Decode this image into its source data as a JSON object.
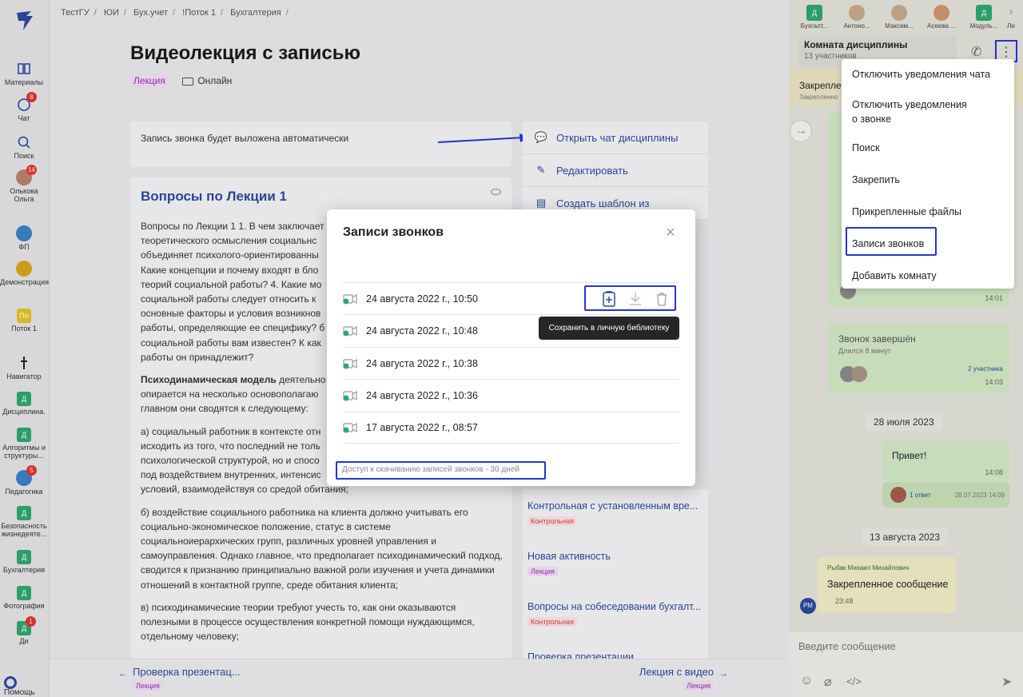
{
  "breadcrumb": [
    "ТестГУ",
    "ЮИ",
    "Бух.учет",
    "!Поток 1",
    "Бухгалтерия"
  ],
  "page": {
    "title": "Видеолекция с записью",
    "type_tag": "Лекция",
    "format": "Онлайн"
  },
  "notice": "Запись звонка будет выложена автоматически",
  "questions": {
    "title": "Вопросы по Лекции 1",
    "paragraphs": [
      "Вопросы по Лекции 1 1. В чем заключает",
      "теоретического осмысления социальнс",
      "объединяет психолого-ориентированны",
      "Какие концепции и почему входят в бло",
      "теорий социальной работы? 4. Какие мо",
      "социальной работы следует относить к",
      "основные факторы и условия возникнов",
      "работы, определяющие ее специфику? б",
      "социальной работы вам известен? К как",
      "работы он принадлежит?"
    ],
    "model_bold": "Психодинамическая модель",
    "model_rest": " деятельно",
    "model_lines": [
      "опирается на несколько основополагаю",
      "главном они сводятся к следующему:"
    ],
    "para_a": [
      "а) социальный работник в контексте отн",
      "исходить из того, что последний не толь",
      "психологической структурой, но и спосо",
      "под воздействием внутренних, интенсис",
      "условий, взаимодействуя со средой обитания;"
    ],
    "para_b": "б) воздействие социального работника на клиента должно учитывать его социально-экономическое положение, статус в системе социальноиерархических групп, различных уровней управления и самоуправления. Однако главное, что предполагает психодинамический подход, сводится к признанию принципиально важной роли изучения и учета динамики отношений в контактной группе, среде обитания клиента;",
    "para_c": "в) психодинамические теории требуют учесть то, как они оказываются полезными в процессе осуществления конкретной помощи нуждающимся, отдельному человеку;"
  },
  "actions": {
    "open_chat": "Открыть чат дисциплины",
    "edit": "Редактировать",
    "create_template": "Создать шаблон из"
  },
  "lessons": [
    {
      "title": "Контрольная с установленным вре...",
      "tag": "Контрольная"
    },
    {
      "title": "Новая активность",
      "tag": "Лекция"
    },
    {
      "title": "Вопросы на собеседовании бухгалт...",
      "tag": "Контрольная"
    },
    {
      "title": "Проверка презентации",
      "tag": ""
    }
  ],
  "footer": {
    "prev_title": "Проверка презентац...",
    "prev_tag": "Лекция",
    "next_title": "Лекция с видео",
    "next_tag": "Лекция"
  },
  "sidebar": {
    "materials": "Материалы",
    "chat": "Чат",
    "chat_badge": "8",
    "search": "Поиск",
    "user": "Олькова Ольга",
    "user_badge": "14",
    "fp": "ФП",
    "demo": "Демонстрация",
    "stream": "Поток 1",
    "stream_initials": "По",
    "navigator": "Навигатор",
    "discipline": "Дисциплина.",
    "algorithms": "Алгоритмы и структуры...",
    "pedagogy": "Педагогика",
    "pedagogy_badge": "5",
    "safety": "Безопасность жизнедеяте...",
    "accounting": "Бухгалтерия",
    "photo": "Фотография",
    "di": "Ди",
    "di_badge": "1",
    "letter": "Д",
    "help": "Помощь"
  },
  "chat_panel": {
    "avatars": [
      "Бухгалт...",
      "Антоно...",
      "Максим...",
      "Асеева ...",
      "Модуль...",
      "Ли"
    ],
    "room_title": "Комната дисциплины",
    "room_sub": "13 участников",
    "pinned_label": "Закреплен",
    "pinned_sub": "Закрепленно",
    "time1": "14:01",
    "call_ended": "Звонок завершён",
    "call_duration": "Длился 8 минут",
    "participants": "2 участника",
    "time2": "14:03",
    "date1": "28 июля 2023",
    "msg_hello": "Привет!",
    "time3": "14:08",
    "reply": "1 ответ",
    "reply_date": "28.07.2023 14:09",
    "date2": "13 августа 2023",
    "author": "Рыбак Михаил Михайлович",
    "pinned_msg": "Закрепленное сообщение",
    "time4": "23:48",
    "author_initials": "РМ",
    "input_placeholder": "Введите сообщение"
  },
  "menu": {
    "items": [
      "Отключить уведомления чата",
      "Отключить уведомления о звонке",
      "Поиск",
      "Закрепить",
      "Прикрепленные файлы",
      "Записи звонков",
      "Добавить комнату"
    ]
  },
  "modal": {
    "title": "Записи звонков",
    "records": [
      "24 августа 2022 г., 10:50",
      "24 августа 2022 г., 10:48",
      "24 августа 2022 г., 10:38",
      "24 августа 2022 г., 10:36",
      "17 августа 2022 г., 08:57"
    ],
    "tooltip": "Сохранить в личную библиотеку",
    "access_note": "Доступ к скачиванию записей звонков - 30 дней"
  },
  "colors": {
    "accent": "#2a4a9c",
    "highlight": "#2535d6",
    "green": "#2ea86d",
    "lecture_tag": "#9b2fae",
    "control_tag": "#d64545"
  }
}
